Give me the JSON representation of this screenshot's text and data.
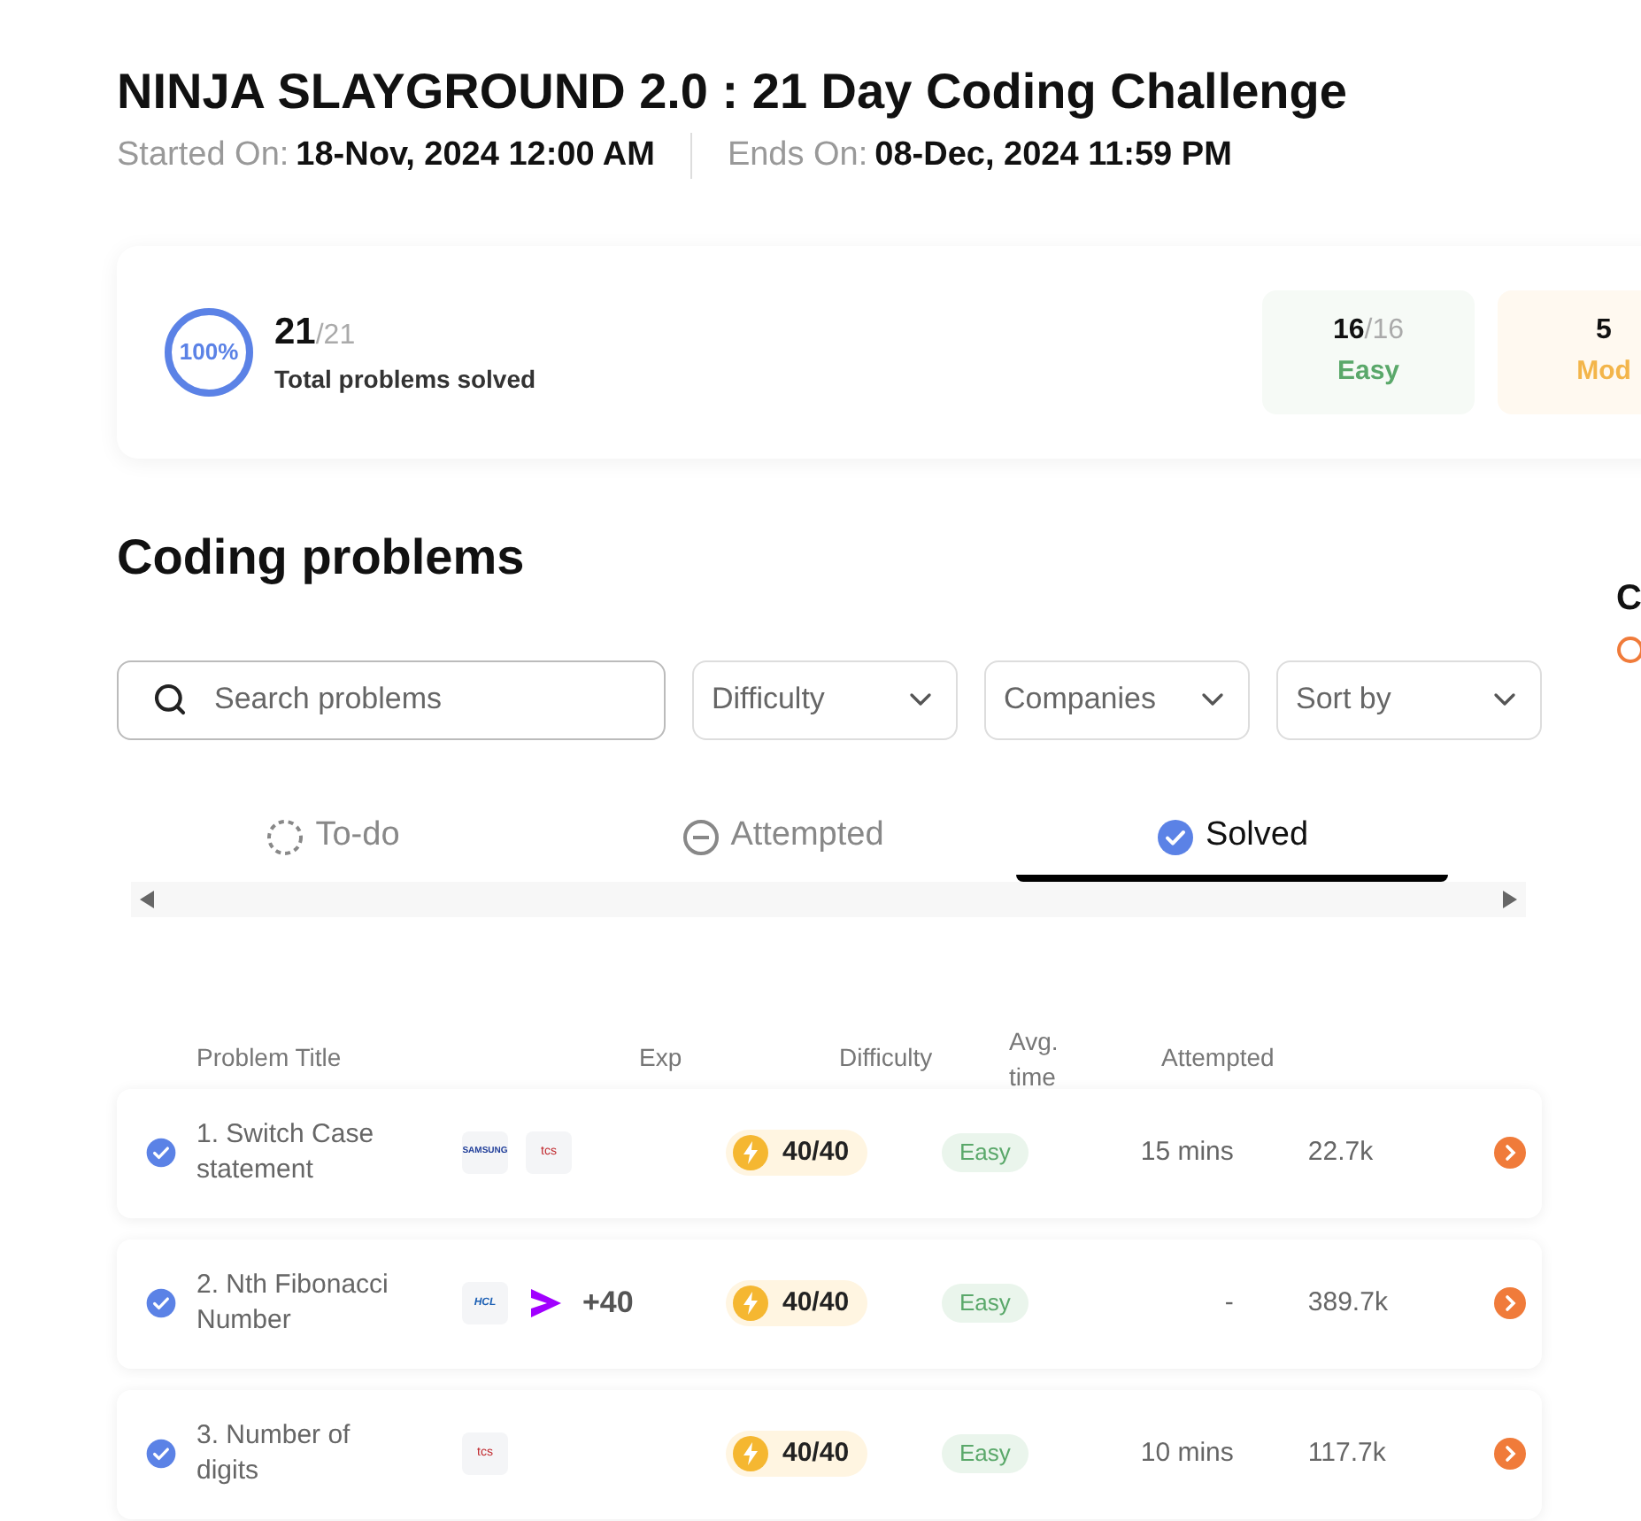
{
  "challenge": {
    "title": "NINJA SLAYGROUND 2.0 : 21 Day Coding Challenge",
    "started_label": "Started On:",
    "started": "18-Nov, 2024 12:00 AM",
    "ends_label": "Ends On:",
    "ends": "08-Dec, 2024 11:59 PM"
  },
  "summary": {
    "percent": "100%",
    "level": 1,
    "solved": "21",
    "total": "/21",
    "caption": "Total problems solved",
    "levels": [
      {
        "kind": "easy",
        "solved": "16",
        "total": "/16",
        "label": "Easy"
      },
      {
        "kind": "moderate",
        "solved": "5",
        "label": "Mod"
      }
    ]
  },
  "section_title": "Coding problems",
  "side_panel": {
    "title": "C"
  },
  "search": {
    "placeholder": "Search problems"
  },
  "filters": [
    "Difficulty",
    "Companies",
    "Sort by"
  ],
  "tabs": [
    {
      "kind": "todo",
      "label": "To-do",
      "selected": false
    },
    {
      "kind": "attempted",
      "label": "Attempted",
      "selected": false
    },
    {
      "kind": "solved",
      "label": "Solved",
      "selected": true
    }
  ],
  "columns": [
    "Problem Title",
    "Exp",
    "Difficulty",
    "Avg. time",
    "Attempted"
  ],
  "rows": [
    {
      "solved": true,
      "title": "1. Switch Case statement",
      "companies": [
        {
          "kind": "samsung",
          "label": "SAMSUNG"
        },
        {
          "kind": "tcs",
          "label": "tcs"
        }
      ],
      "exp": "40/40",
      "difficulty": "Easy",
      "avg_time": "15 mins",
      "attempted": "22.7k"
    },
    {
      "solved": true,
      "title": "2. Nth Fibonacci Number",
      "companies": [
        {
          "kind": "hcl",
          "label": "HCL"
        },
        {
          "kind": "accenture"
        }
      ],
      "more": "+40",
      "exp": "40/40",
      "difficulty": "Easy",
      "avg_time": "-",
      "attempted": "389.7k"
    },
    {
      "solved": true,
      "title": "3. Number of digits",
      "companies": [
        {
          "kind": "tcs",
          "label": "tcs"
        }
      ],
      "exp": "40/40",
      "difficulty": "Easy",
      "avg_time": "10 mins",
      "attempted": "117.7k"
    }
  ]
}
